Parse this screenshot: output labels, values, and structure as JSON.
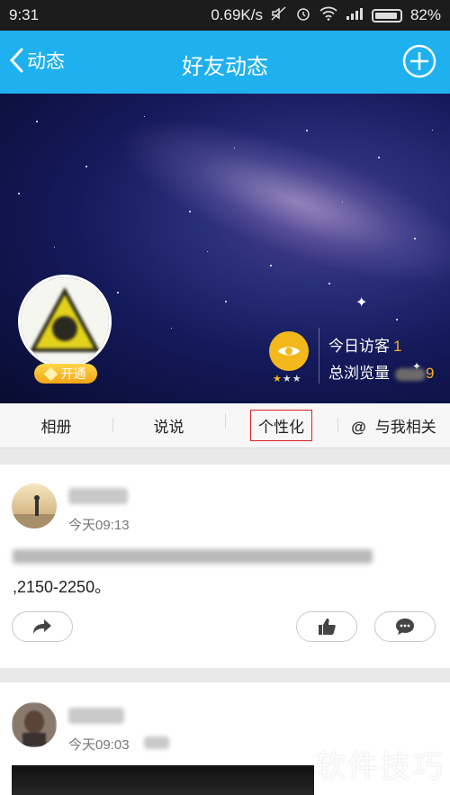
{
  "status_bar": {
    "time": "9:31",
    "network_speed": "0.69K/s",
    "battery": "82%",
    "icons": [
      "mute-icon",
      "alarm-icon",
      "wifi-icon",
      "signal-icon",
      "battery-icon"
    ]
  },
  "nav": {
    "back_label": "动态",
    "title": "好友动态",
    "add_icon": "plus-circle-icon"
  },
  "profile": {
    "vip_label": "开通",
    "visitor_today_label": "今日访客",
    "visitor_today_count": "1",
    "total_views_label": "总浏览量",
    "total_views_visible_digit": "9",
    "level_stars": 1,
    "level_stars_max": 3
  },
  "tabs": [
    {
      "label": "相册"
    },
    {
      "label": "说说"
    },
    {
      "label": "个性化"
    },
    {
      "label": "与我相关",
      "prefix": "@"
    }
  ],
  "posts": [
    {
      "time": "今天09:13",
      "text_visible": ",2150-2250。",
      "actions": [
        "share-icon",
        "like-icon",
        "comment-icon"
      ]
    },
    {
      "time": "今天09:03"
    }
  ],
  "watermark": "软件技巧",
  "colors": {
    "nav_blue": "#1fb0ef",
    "accent_gold": "#f3b81c",
    "tab_highlight": "#dd2222"
  }
}
